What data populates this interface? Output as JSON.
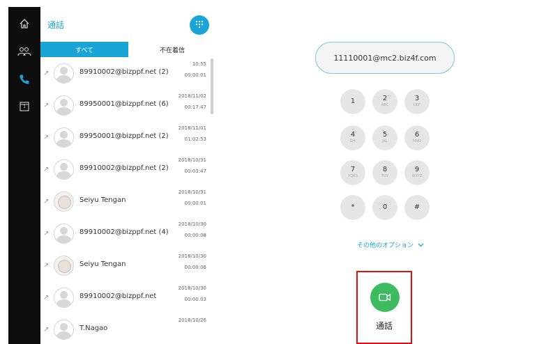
{
  "nav": {
    "items": [
      {
        "id": "home",
        "icon": "home-icon"
      },
      {
        "id": "contacts",
        "icon": "contacts-icon"
      },
      {
        "id": "calls",
        "icon": "phone-icon"
      },
      {
        "id": "calendar",
        "icon": "calendar-icon"
      }
    ],
    "calendar_day": "1"
  },
  "history": {
    "title": "通話",
    "tabs": [
      {
        "label": "すべて",
        "selected": true
      },
      {
        "label": "不在着信",
        "selected": false
      }
    ],
    "items": [
      {
        "name": "89910002@bizppf.net (2)",
        "date": "10:55",
        "duration": "00:00:01",
        "avatar": "default"
      },
      {
        "name": "89950001@bizppf.net (6)",
        "date": "2018/11/02",
        "duration": "00:17:47",
        "avatar": "default"
      },
      {
        "name": "89950001@bizppf.net (2)",
        "date": "2018/11/01",
        "duration": "01:02:53",
        "avatar": "default"
      },
      {
        "name": "89910002@bizppf.net (2)",
        "date": "2018/10/31",
        "duration": "00:03:47",
        "avatar": "default"
      },
      {
        "name": "Seiyu Tengan",
        "date": "2018/10/31",
        "duration": "00:00:01",
        "avatar": "photo"
      },
      {
        "name": "89910002@bizppf.net (4)",
        "date": "2018/10/30",
        "duration": "00:00:08",
        "avatar": "default"
      },
      {
        "name": "Seiyu Tengan",
        "date": "2018/10/30",
        "duration": "00:00:06",
        "avatar": "photo"
      },
      {
        "name": "89910002@bizppf.net",
        "date": "2018/10/30",
        "duration": "00:00:03",
        "avatar": "default"
      },
      {
        "name": "T.Nagao",
        "date": "2018/10/26",
        "duration": "",
        "avatar": "default"
      }
    ]
  },
  "dialer": {
    "address_value": "11110001@mc2.biz4f.com",
    "keys": [
      {
        "digit": "1",
        "letters": ""
      },
      {
        "digit": "2",
        "letters": "ABC"
      },
      {
        "digit": "3",
        "letters": "DEF"
      },
      {
        "digit": "4",
        "letters": "GHI"
      },
      {
        "digit": "5",
        "letters": "JKL"
      },
      {
        "digit": "6",
        "letters": "MNO"
      },
      {
        "digit": "7",
        "letters": "PQRS"
      },
      {
        "digit": "8",
        "letters": "TUV"
      },
      {
        "digit": "9",
        "letters": "WXYZ"
      },
      {
        "digit": "*",
        "letters": ""
      },
      {
        "digit": "0",
        "letters": ""
      },
      {
        "digit": "#",
        "letters": ""
      }
    ],
    "more_options": "その他のオプション",
    "call_label": "通話"
  },
  "colors": {
    "accent": "#1aa5d6",
    "call_green": "#3dbb60",
    "highlight_red": "#e01010",
    "rail": "#0e0e0e"
  }
}
